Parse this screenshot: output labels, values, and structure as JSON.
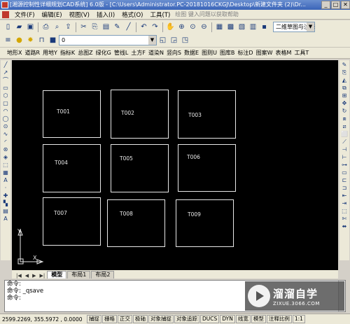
{
  "window": {
    "title": "[湘源控制性详细规划CAD系统] 6.0版 - [C:\\Users\\Administrator.PC-20181016CKGJ\\Desktop\\新建文件夹 (2)\\Dr...",
    "buttons": [
      "_",
      "□",
      "✕"
    ]
  },
  "menubar": {
    "items": [
      "文件(F)",
      "编辑(E)",
      "视图(V)",
      "插入(I)",
      "格式(O)",
      "工具(T)"
    ],
    "search_hint": "绘图 键入问题以获取帮助"
  },
  "toolbar1": {
    "icons": [
      "new-icon",
      "open-icon",
      "save-icon",
      "print-icon",
      "preview-icon",
      "publish-icon",
      "cut-icon",
      "copy-icon",
      "paste-icon",
      "match-icon",
      "brush-icon",
      "undo-icon",
      "redo-icon",
      "pan-icon",
      "zoom-realtime-icon",
      "zoom-window-icon",
      "zoom-previous-icon",
      "properties-icon",
      "design-center-icon",
      "tool-palette-icon",
      "calculator-icon",
      "layout-icon"
    ],
    "workspace": "二维草图与注释"
  },
  "toolbar2": {
    "layer_value": "0"
  },
  "categories": [
    "地形X",
    "道路R",
    "用地Y",
    "指标K",
    "总图Z",
    "绿化G",
    "管线L",
    "土方F",
    "道染N",
    "竖向S",
    "数据E",
    "图则U",
    "图库B",
    "标注D",
    "图案W",
    "表格M",
    "工具T"
  ],
  "left_tools": [
    "╱",
    "↗",
    "⌒",
    "▭",
    "⬡",
    "▢",
    "◠",
    "◯",
    "⊙",
    "∿",
    "◜",
    "⊛",
    "◈",
    "⬚",
    "▦",
    "A",
    "·",
    "✚",
    "▚",
    "▤",
    "A"
  ],
  "right_tools": [
    "✎",
    "⎘",
    "◭",
    "⧉",
    "⊞",
    "✥",
    "↻",
    "⧈",
    "⧄",
    "⬜",
    "⟋",
    "⊣",
    "⊢",
    "⊶",
    "▭",
    "⊏",
    "⊐",
    "⇤",
    "⇥",
    "⬚",
    "✄",
    "⬌"
  ],
  "drawing": {
    "cells": [
      {
        "label": "T001"
      },
      {
        "label": "T002"
      },
      {
        "label": "T003"
      },
      {
        "label": "T004"
      },
      {
        "label": "T005"
      },
      {
        "label": "T006"
      },
      {
        "label": "T007"
      },
      {
        "label": "T008"
      },
      {
        "label": "T009"
      }
    ],
    "axis_x": "X",
    "axis_y": "Y"
  },
  "tabs": {
    "nav": [
      "|◀",
      "◀",
      "▶",
      "▶|"
    ],
    "items": [
      "模型",
      "布局1",
      "布局2"
    ],
    "active": "模型"
  },
  "command": {
    "lines": [
      "命令:",
      "命令: _qsave",
      "命令:"
    ]
  },
  "watermark": {
    "brand": "溜溜自学",
    "site": "ZIXUE.3066.COM"
  },
  "status": {
    "coords": "2599.2269, 355.5972 , 0.0000",
    "buttons": [
      "捕捉",
      "栅格",
      "正交",
      "极轴",
      "对象捕捉",
      "对象追踪",
      "DUCS",
      "DYN",
      "线宽",
      "模型",
      "注释比例",
      "1:1"
    ]
  }
}
